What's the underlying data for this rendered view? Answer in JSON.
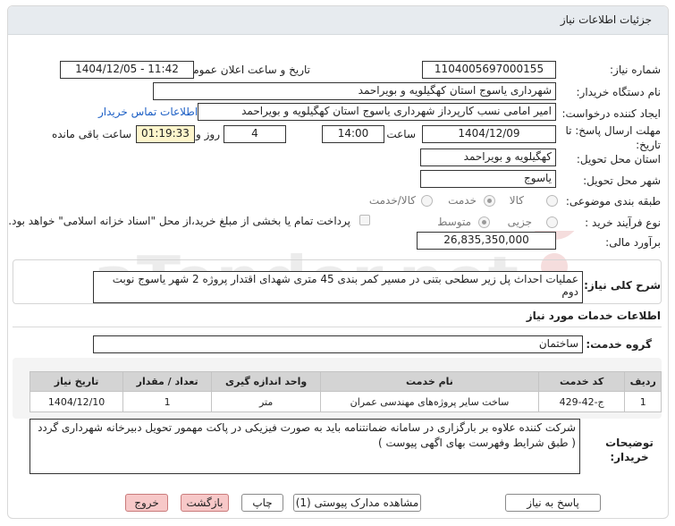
{
  "title": "جزئیات اطلاعات نیاز",
  "fields": {
    "need_number_label": "شماره نیاز:",
    "need_number": "1104005697000155",
    "announce_label": "تاریخ و ساعت اعلان عمومی:",
    "announce_value": "1404/12/05 - 11:42",
    "buyer_org_label": "نام دستگاه خریدار:",
    "buyer_org": "شهرداری یاسوج استان کهگیلویه و بویراحمد",
    "requester_label": "ایجاد کننده درخواست:",
    "requester": "امیر امامی نسب کارپرداز شهرداری یاسوج استان کهگیلویه و بویراحمد",
    "contact_link": "اطلاعات تماس خریدار",
    "deadline_label": "مهلت ارسال پاسخ: تا تاریخ:",
    "deadline_date": "1404/12/09",
    "hour_label": "ساعت",
    "deadline_time": "14:00",
    "days": "4",
    "days_label": "روز و",
    "remaining_time": "01:19:33",
    "remaining_label": "ساعت باقی مانده",
    "province_label": "استان محل تحویل:",
    "province": "کهگیلویه و بویراحمد",
    "city_label": "شهر محل تحویل:",
    "city": "یاسوج",
    "category_label": "طبقه بندی موضوعی:",
    "category_options": [
      "کالا",
      "خدمت",
      "کالا/خدمت"
    ],
    "category_selected": "خدمت",
    "process_label": "نوع فرآیند خرید :",
    "process_options": [
      "جزیی",
      "متوسط"
    ],
    "process_selected": "متوسط",
    "payment_note": "پرداخت تمام یا بخشی از مبلغ خرید،از محل \"اسناد خزانه اسلامی\" خواهد بود.",
    "budget_label": "برآورد مالی:",
    "budget": "26,835,350,000"
  },
  "description": {
    "label": "شرح کلی نیاز:",
    "text": "عملیات احداث پل زیر سطحی بتنی در مسیر کمر بندی 45 متری شهدای اقتدار پروژه 2 شهر یاسوج نوبت دوم"
  },
  "services": {
    "heading": "اطلاعات خدمات مورد نیاز",
    "group_label": "گروه خدمت:",
    "group": "ساختمان",
    "columns": [
      "ردیف",
      "کد خدمت",
      "نام خدمت",
      "واحد اندازه گیری",
      "تعداد / مقدار",
      "تاریخ نیاز"
    ],
    "rows": [
      [
        "1",
        "ج-42-429",
        "ساخت سایر پروژه‌های مهندسی عمران",
        "متر",
        "1",
        "1404/12/10"
      ]
    ]
  },
  "buyer_notes": {
    "label": "توضیحات خریدار:",
    "text": "شرکت کننده علاوه بر بارگزاری در سامانه ضمانتنامه باید به صورت فیزیکی در پاکت مهمور تحویل دبیرخانه شهرداری گردد ( طبق شرایط وفهرست بهای اگهی پیوست )"
  },
  "buttons": {
    "reply": "پاسخ به نیاز",
    "view_docs": "مشاهده مدارک پیوستی (1)",
    "print": "چاپ",
    "back": "بازگشت",
    "exit": "خروج"
  },
  "watermark": "AriaTender.net",
  "colors": {
    "titlebar": "#e7ebef",
    "link": "#1c5fc5",
    "red_button": "#f7c8c8",
    "table_header": "#d4d4d4"
  }
}
